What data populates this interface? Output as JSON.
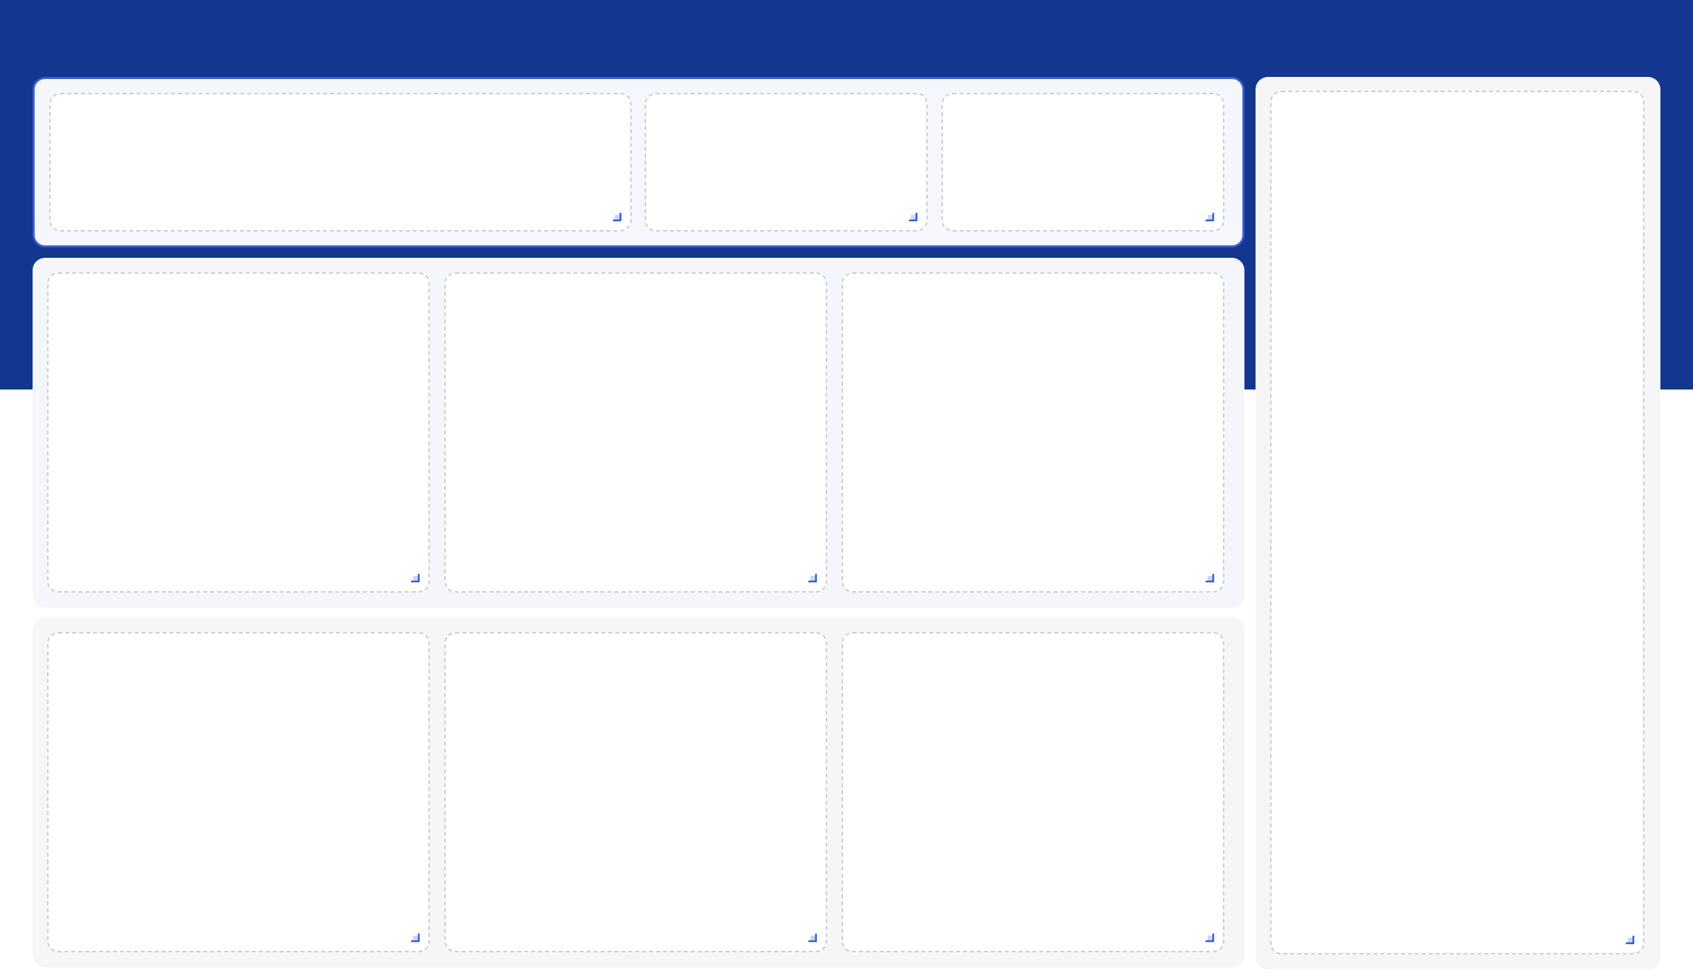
{
  "theme": {
    "accent": "#13368f",
    "focus_border": "#3b5fd0",
    "handle": "#2f5bd8",
    "slot_border": "#c9ccd2"
  },
  "layout_editor": {
    "sections": [
      {
        "id": "top-summary-row",
        "slots": 3
      },
      {
        "id": "middle-panel-row",
        "slots": 3
      },
      {
        "id": "bottom-panel-row",
        "slots": 3
      },
      {
        "id": "right-sidebar",
        "slots": 1
      }
    ],
    "handle_icon": "resize-handle-icon"
  }
}
